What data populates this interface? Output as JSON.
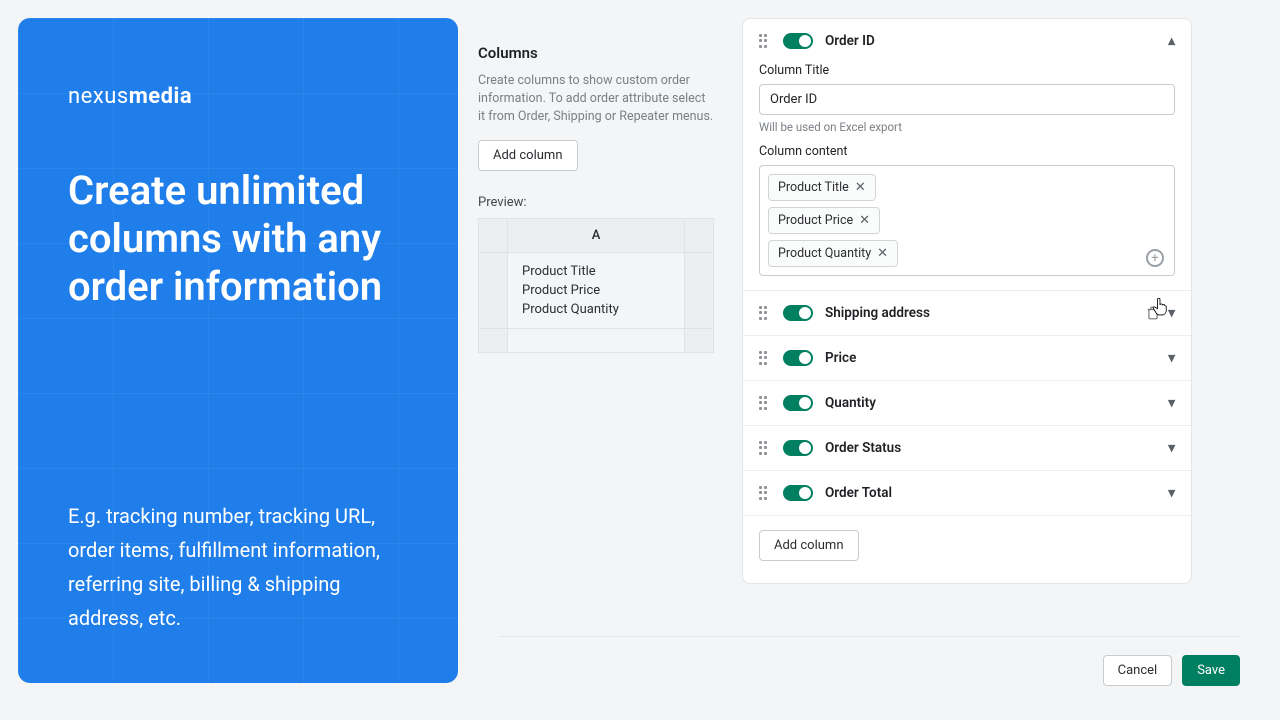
{
  "brand": {
    "first": "nexus",
    "second": "media"
  },
  "promo": {
    "headline": "Create unlimited columns with any order information",
    "sub": "E.g. tracking number, tracking URL, order items, fulfillment information, referring site, billing & shipping address, etc."
  },
  "columns_panel": {
    "title": "Columns",
    "desc": "Create columns to show custom order information. To add order attribute select it from Order, Shipping or Repeater menus.",
    "add_button": "Add column",
    "preview_label": "Preview:",
    "preview_header": "A",
    "preview_rows": [
      "Product Title",
      "Product Price",
      "Product Quantity"
    ]
  },
  "editor": {
    "items": [
      {
        "label": "Order ID",
        "expanded": true
      },
      {
        "label": "Shipping address",
        "expanded": false,
        "trash": true
      },
      {
        "label": "Price",
        "expanded": false
      },
      {
        "label": "Quantity",
        "expanded": false
      },
      {
        "label": "Order Status",
        "expanded": false
      },
      {
        "label": "Order Total",
        "expanded": false
      }
    ],
    "expanded": {
      "title_label": "Column Title",
      "title_value": "Order ID",
      "title_hint": "Will be used on Excel export",
      "content_label": "Column content",
      "tags": [
        "Product Title",
        "Product Price",
        "Product Quantity"
      ]
    },
    "add_button": "Add column"
  },
  "footer": {
    "cancel": "Cancel",
    "save": "Save"
  }
}
